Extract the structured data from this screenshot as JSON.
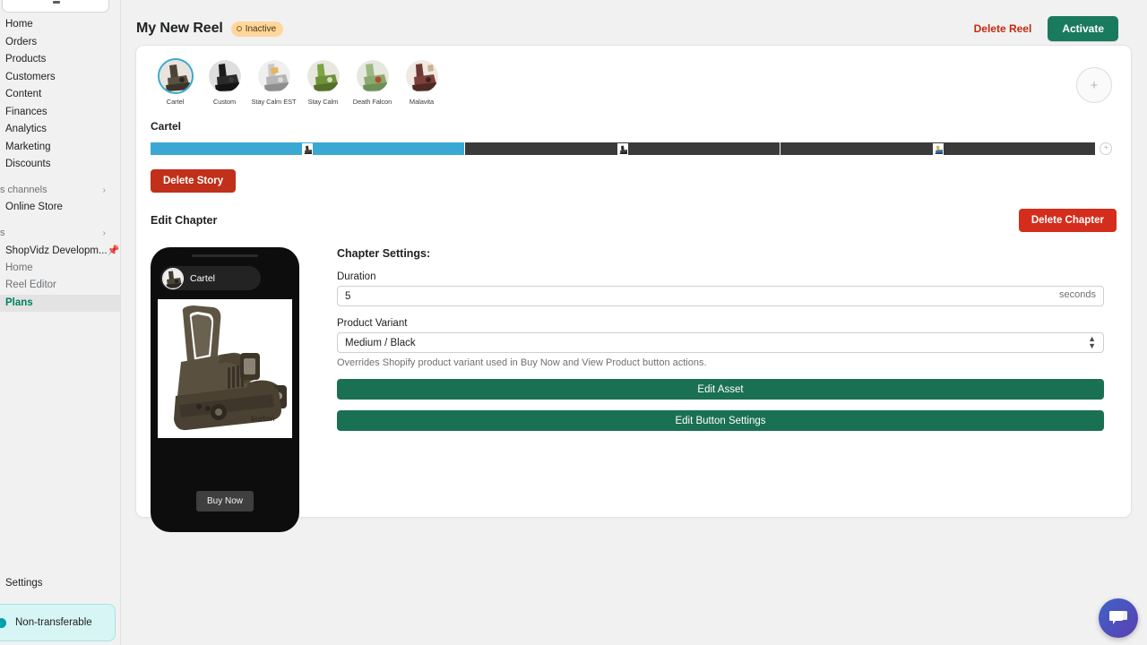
{
  "sidebar": {
    "search_placeholder": "",
    "nav_items": [
      {
        "label": "Home"
      },
      {
        "label": "Orders"
      },
      {
        "label": "Products"
      },
      {
        "label": "Customers"
      },
      {
        "label": "Content"
      },
      {
        "label": "Finances"
      },
      {
        "label": "Analytics"
      },
      {
        "label": "Marketing"
      },
      {
        "label": "Discounts"
      }
    ],
    "sales_channels_label": "s channels",
    "sales_channels_items": [
      {
        "label": "Online Store"
      }
    ],
    "apps_label": "s",
    "app_name": "ShopVidz Developm...",
    "app_items": [
      {
        "label": "Home",
        "active": false
      },
      {
        "label": "Reel Editor",
        "active": false
      },
      {
        "label": "Plans",
        "active": true
      }
    ],
    "settings_label": "Settings",
    "plan_badge": "Non-transferable"
  },
  "header": {
    "title": "My New Reel",
    "status_badge": "Inactive",
    "delete_reel_label": "Delete Reel",
    "activate_label": "Activate"
  },
  "stories": {
    "items": [
      {
        "name": "Cartel",
        "selected": true
      },
      {
        "name": "Custom",
        "selected": false
      },
      {
        "name": "Stay Calm EST",
        "selected": false
      },
      {
        "name": "Stay Calm",
        "selected": false
      },
      {
        "name": "Death Falcon",
        "selected": false
      },
      {
        "name": "Malavita",
        "selected": false
      }
    ],
    "add_label": "+"
  },
  "story": {
    "title": "Cartel",
    "chapters": [
      {
        "index": 1,
        "state": "active",
        "width_pct": 33.2
      },
      {
        "index": 2,
        "state": "idle",
        "width_pct": 33.2
      },
      {
        "index": 3,
        "state": "idle",
        "width_pct": 33.2
      }
    ],
    "add_chapter_label": "+",
    "delete_story_label": "Delete Story"
  },
  "chapter": {
    "heading": "Edit Chapter",
    "delete_label": "Delete Chapter"
  },
  "preview": {
    "username": "Cartel",
    "buy_now_label": "Buy Now"
  },
  "settings": {
    "heading": "Chapter Settings:",
    "duration_label": "Duration",
    "duration_value": "5",
    "duration_suffix": "seconds",
    "variant_label": "Product Variant",
    "variant_value": "Medium / Black",
    "variant_options": [
      "Medium / Black"
    ],
    "variant_helper": "Overrides Shopify product variant used in Buy Now and View Product button actions.",
    "edit_asset_label": "Edit Asset",
    "edit_button_settings_label": "Edit Button Settings"
  },
  "colors": {
    "accent_green": "#1a7a5e",
    "danger_red": "#d42d1c",
    "timeline_active": "#3ba8d4",
    "timeline_idle": "#3a3a3a",
    "badge_amber": "#ffd79d"
  }
}
